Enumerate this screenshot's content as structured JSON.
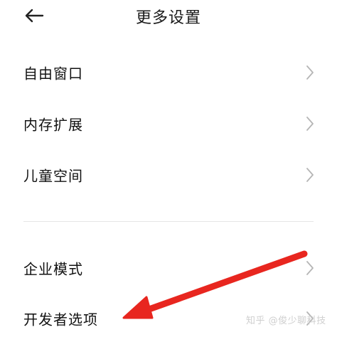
{
  "header": {
    "back_icon": "arrow-left-icon",
    "title": "更多设置"
  },
  "sections": [
    {
      "items": [
        {
          "label": "自由窗口"
        },
        {
          "label": "内存扩展"
        },
        {
          "label": "儿童空间"
        }
      ]
    },
    {
      "items": [
        {
          "label": "企业模式"
        },
        {
          "label": "开发者选项"
        }
      ]
    }
  ],
  "watermark": "知乎 @俊少聊科技",
  "annotation": {
    "icon": "red-arrow-icon",
    "color": "#e8261f"
  },
  "colors": {
    "text": "#111111",
    "chevron": "#b5b5b5",
    "divider": "#e6e6e6"
  }
}
